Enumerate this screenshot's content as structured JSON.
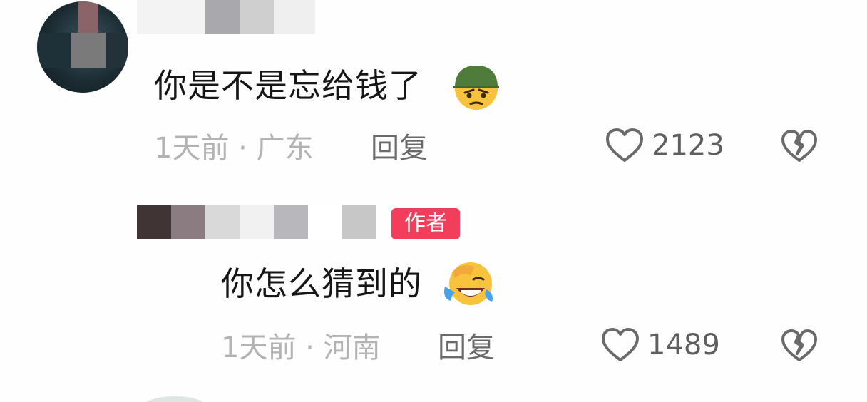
{
  "comments": [
    {
      "text": "你是不是忘给钱了",
      "emoji": "angry-helmet-emoji",
      "time": "1天前 · 广东",
      "reply_label": "回复",
      "likes": "2123",
      "like_icon": "heart-outline-icon",
      "dislike_icon": "broken-heart-icon"
    },
    {
      "badge": "作者",
      "text": "你怎么猜到的",
      "emoji": "laughing-facepalm-emoji",
      "time": "1天前 · 河南",
      "reply_label": "回复",
      "likes": "1489",
      "like_icon": "heart-outline-icon",
      "dislike_icon": "broken-heart-icon"
    }
  ],
  "colors": {
    "badge_bg": "#f23d5b",
    "meta_text": "#b3b3b3",
    "reply_text": "#6a6a6a",
    "body_text": "#161616"
  }
}
